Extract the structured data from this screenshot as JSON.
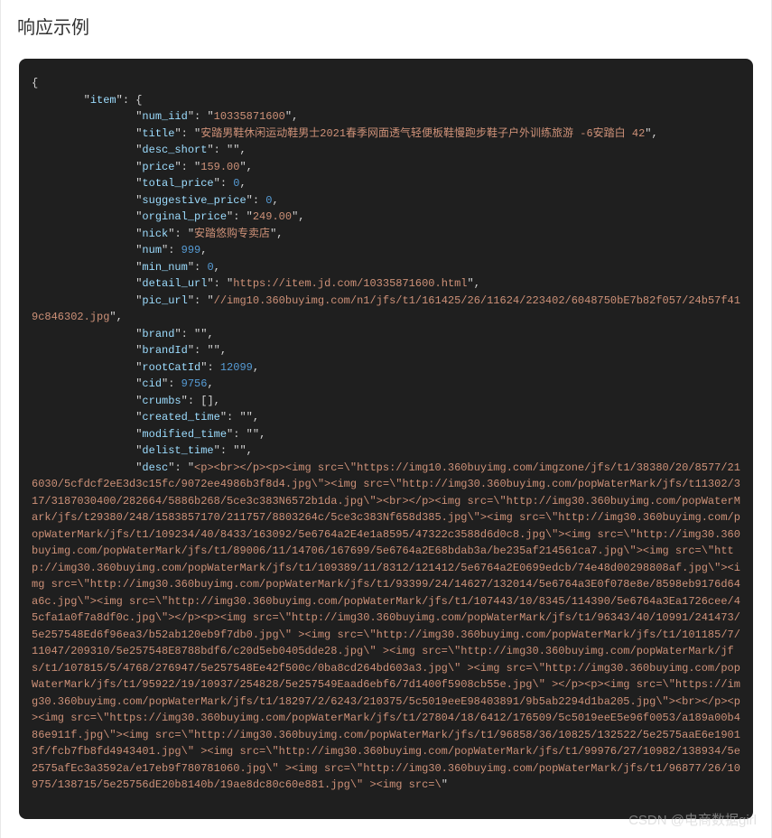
{
  "heading": "响应示例",
  "watermark": "CSDN @电商数据girl",
  "json": {
    "item": {
      "num_iid": "10335871600",
      "title": "安踏男鞋休闲运动鞋男士2021春季网面透气轻便板鞋慢跑步鞋子户外训练旅游 -6安踏白 42",
      "desc_short": "",
      "price": "159.00",
      "total_price": 0,
      "suggestive_price": 0,
      "orginal_price": "249.00",
      "nick": "安踏悠购专卖店",
      "num": 999,
      "min_num": 0,
      "detail_url": "https://item.jd.com/10335871600.html",
      "pic_url": "//img10.360buyimg.com/n1/jfs/t1/161425/26/11624/223402/6048750bE7b82f057/24b57f419c846302.jpg",
      "brand": "",
      "brandId": "",
      "rootCatId": 12099,
      "cid": 9756,
      "crumbs": [],
      "created_time": "",
      "modified_time": "",
      "delist_time": "",
      "desc": "<p><br></p><p><img src=\\\"https://img10.360buyimg.com/imgzone/jfs/t1/38380/20/8577/216030/5cfdcf2eE3d3c15fc/9072ee4986b3f8d4.jpg\\\"><img src=\\\"http://img30.360buyimg.com/popWaterMark/jfs/t11302/317/3187030400/282664/5886b268/5ce3c383N6572b1da.jpg\\\"><br></p><img src=\\\"http://img30.360buyimg.com/popWaterMark/jfs/t29380/248/1583857170/211757/8803264c/5ce3c383Nf658d385.jpg\\\"><img src=\\\"http://img30.360buyimg.com/popWaterMark/jfs/t1/109234/40/8433/163092/5e6764a2E4e1a8595/47322c3588d6d0c8.jpg\\\"><img src=\\\"http://img30.360buyimg.com/popWaterMark/jfs/t1/89006/11/14706/167699/5e6764a2E68bdab3a/be235af214561ca7.jpg\\\"><img src=\\\"http://img30.360buyimg.com/popWaterMark/jfs/t1/109389/11/8312/121412/5e6764a2E0699edcb/74e48d00298808af.jpg\\\"><img src=\\\"http://img30.360buyimg.com/popWaterMark/jfs/t1/93399/24/14627/132014/5e6764a3E0f078e8e/8598eb9176d64a6c.jpg\\\"><img src=\\\"http://img30.360buyimg.com/popWaterMark/jfs/t1/107443/10/8345/114390/5e6764a3Ea1726cee/45cfa1a0f7a8df0c.jpg\\\"></p><p><img src=\\\"http://img30.360buyimg.com/popWaterMark/jfs/t1/96343/40/10991/241473/5e257548Ed6f96ea3/b52ab120eb9f7db0.jpg\\\" ><img src=\\\"http://img30.360buyimg.com/popWaterMark/jfs/t1/101185/7/11047/209310/5e257548E8788bdf6/c20d5eb0405dde28.jpg\\\" ><img src=\\\"http://img30.360buyimg.com/popWaterMark/jfs/t1/107815/5/4768/276947/5e257548Ee42f500c/0ba8cd264bd603a3.jpg\\\" ><img src=\\\"http://img30.360buyimg.com/popWaterMark/jfs/t1/95922/19/10937/254828/5e257549Eaad6ebf6/7d1400f5908cb55e.jpg\\\" ></p><p><img src=\\\"https://img30.360buyimg.com/popWaterMark/jfs/t1/18297/2/6243/210375/5c5019eeE98403891/9b5ab2294d1ba205.jpg\\\"><br></p><p><img src=\\\"https://img30.360buyimg.com/popWaterMark/jfs/t1/27804/18/6412/176509/5c5019eeE5e96f0053/a189a00b486e911f.jpg\\\"><img src=\\\"http://img30.360buyimg.com/popWaterMark/jfs/t1/96858/36/10825/132522/5e2575aaE6e19013f/fcb7fb8fd4943401.jpg\\\" ><img src=\\\"http://img30.360buyimg.com/popWaterMark/jfs/t1/99976/27/10982/138934/5e2575afEc3a3592a/e17eb9f780781060.jpg\\\" ><img src=\\\"http://img30.360buyimg.com/popWaterMark/jfs/t1/96877/26/10975/138715/5e25756dE20b8140b/19ae8dc80c60e881.jpg\\\" ><img src=\\"
    }
  },
  "indent_unit": "        "
}
